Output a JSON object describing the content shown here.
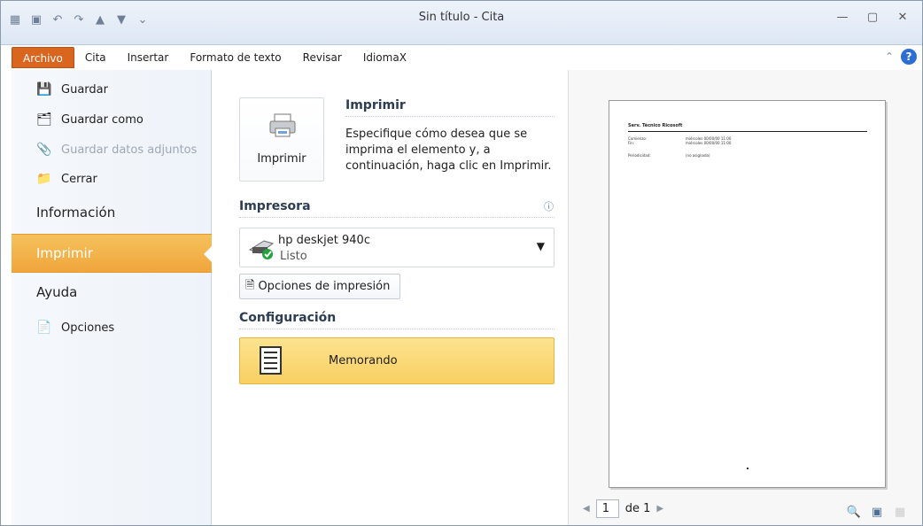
{
  "window": {
    "title": "Sin título - Cita"
  },
  "quick_access": {
    "icons": [
      "calendar-icon",
      "save-icon",
      "undo-icon",
      "redo-icon",
      "up-icon",
      "down-icon",
      "customize-icon"
    ]
  },
  "tabs": [
    "Archivo",
    "Cita",
    "Insertar",
    "Formato de texto",
    "Revisar",
    "IdiomaX"
  ],
  "backstage": {
    "guardar": "Guardar",
    "guardar_como": "Guardar como",
    "guardar_adjuntos": "Guardar datos adjuntos",
    "cerrar": "Cerrar",
    "informacion": "Información",
    "imprimir": "Imprimir",
    "ayuda": "Ayuda",
    "opciones": "Opciones"
  },
  "print": {
    "button": "Imprimir",
    "heading": "Imprimir",
    "description": "Especifique cómo desea que se imprima el elemento y, a continuación, haga clic en Imprimir.",
    "printer_heading": "Impresora",
    "printer_name": "hp deskjet 940c",
    "printer_status": "Listo",
    "options_button": "Opciones de impresión",
    "settings_heading": "Configuración",
    "style": "Memorando"
  },
  "preview": {
    "page_title": "Serv. Técnico Ricosoft",
    "rows": [
      "Comienzo:",
      "Fin:",
      "Periodicidad:"
    ],
    "values": [
      "miércoles 00/00/00 11:00",
      "miércoles 00/00/00 11:00",
      "(no asignada)"
    ],
    "page": "1",
    "of": "de 1"
  },
  "colors": {
    "accent": "#d9651f",
    "selected": "#f0a63b",
    "memo": "#f8cf62"
  }
}
